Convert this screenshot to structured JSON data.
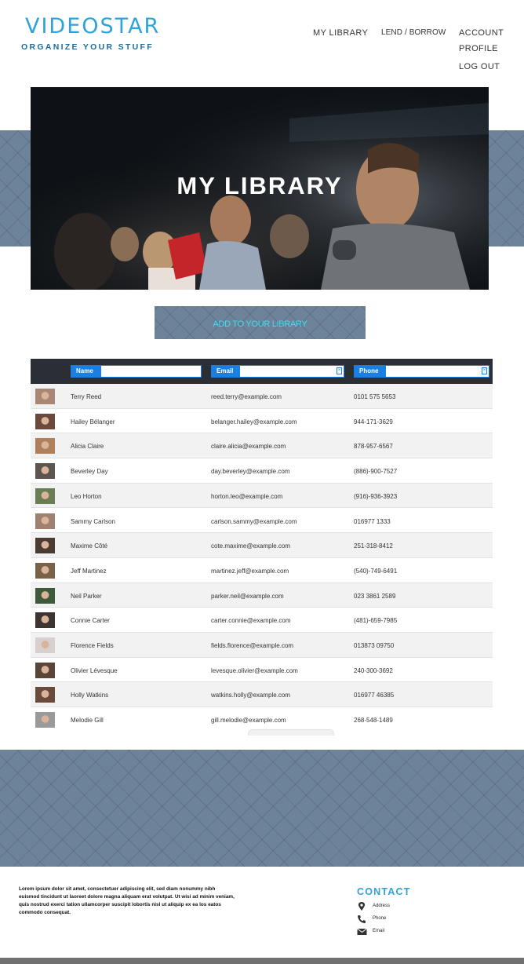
{
  "brand": {
    "name": "VIDEOSTAR",
    "tagline": "ORGANIZE YOUR STUFF"
  },
  "nav": {
    "library": "MY LIBRARY",
    "lend": "LEND / BORROW",
    "account": "ACCOUNT",
    "profile": "PROFILE",
    "logout": "LOG OUT"
  },
  "hero": {
    "title": "MY LIBRARY"
  },
  "add_button": {
    "label": "ADD TO YOUR LIBRARY"
  },
  "table": {
    "columns": [
      "Name",
      "Email",
      "Phone"
    ],
    "rows": [
      {
        "name": "Terry Reed",
        "email": "reed.terry@example.com",
        "phone": "0101 575 5653"
      },
      {
        "name": "Hailey Bélanger",
        "email": "belanger.hailey@example.com",
        "phone": "944-171-3629"
      },
      {
        "name": "Alicia Claire",
        "email": "claire.alicia@example.com",
        "phone": "878-957-6567"
      },
      {
        "name": "Beverley Day",
        "email": "day.beverley@example.com",
        "phone": "(886)-900-7527"
      },
      {
        "name": "Leo Horton",
        "email": "horton.leo@example.com",
        "phone": "(916)-936-3923"
      },
      {
        "name": "Sammy Carlson",
        "email": "carlson.sammy@example.com",
        "phone": "016977 1333"
      },
      {
        "name": "Maxime Côté",
        "email": "cote.maxime@example.com",
        "phone": "251-318-8412"
      },
      {
        "name": "Jeff Martinez",
        "email": "martinez.jeff@example.com",
        "phone": "(540)-749-6491"
      },
      {
        "name": "Neil Parker",
        "email": "parker.neil@example.com",
        "phone": "023 3861 2589"
      },
      {
        "name": "Connie Carter",
        "email": "carter.connie@example.com",
        "phone": "(481)-659-7985"
      },
      {
        "name": "Florence Fields",
        "email": "fields.florence@example.com",
        "phone": "013873 09750"
      },
      {
        "name": "Olivier Lévesque",
        "email": "levesque.olivier@example.com",
        "phone": "240-300-3692"
      },
      {
        "name": "Holly Watkins",
        "email": "watkins.holly@example.com",
        "phone": "016977 46385"
      },
      {
        "name": "Melodie Gill",
        "email": "gill.melodie@example.com",
        "phone": "268-548-1489"
      }
    ]
  },
  "footer": {
    "lorem": "Lorem ipsum dolor sit amet, consectetuer adipiscing elit, sed diam nonummy nibh euismod tincidunt ut laoreet dolore magna aliquam erat volutpat. Ut wisi ad minim veniam, quis nostrud exerci tation ullamcorper suscipit lobortis nisl ut aliquip ex ea los eatos commodo consequat.",
    "contact_title": "CONTACT",
    "address": "Address",
    "phone": "Phone",
    "email": "Email"
  },
  "colors": {
    "accent": "#2ea3d9",
    "band": "#6d8399",
    "button_text": "#3ee0f0",
    "filter_blue": "#1a7fe0"
  }
}
